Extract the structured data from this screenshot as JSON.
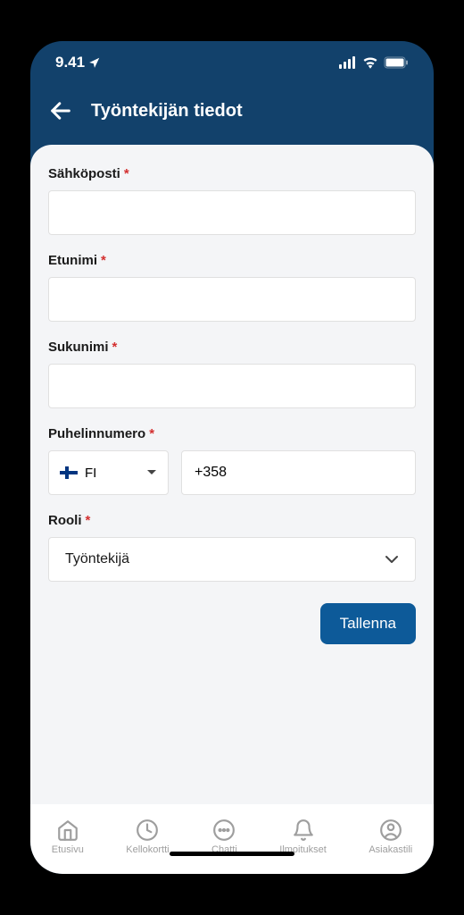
{
  "status": {
    "time": "9.41"
  },
  "header": {
    "title": "Työntekijän tiedot"
  },
  "form": {
    "email": {
      "label": "Sähköposti",
      "value": ""
    },
    "firstname": {
      "label": "Etunimi",
      "value": ""
    },
    "lastname": {
      "label": "Sukunimi",
      "value": ""
    },
    "phone": {
      "label": "Puhelinnumero",
      "country": "FI",
      "prefix": "+358"
    },
    "role": {
      "label": "Rooli",
      "value": "Työntekijä"
    },
    "save": "Tallenna"
  },
  "nav": {
    "home": "Etusivu",
    "clock": "Kellokortti",
    "chat": "Chatti",
    "notify": "Ilmoitukset",
    "account": "Asiakastili"
  }
}
